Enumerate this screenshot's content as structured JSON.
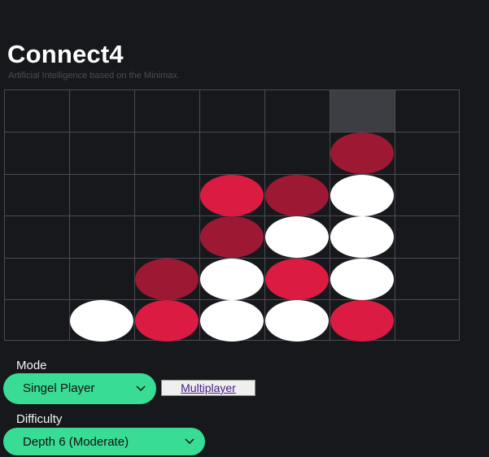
{
  "header": {
    "title": "Connect4",
    "subtitle": "Artificial Intelligence based on the Minimax."
  },
  "board": {
    "columns": 7,
    "rows": 6,
    "hover_column": 5,
    "colors": {
      "white": "#ffffff",
      "red": "#dc1b42",
      "dark": "#9d1933",
      "highlight": "#3c3e43",
      "grid": "#4a4c52"
    },
    "cells": [
      [
        "",
        "",
        "",
        "",
        "",
        "",
        ""
      ],
      [
        "",
        "",
        "",
        "",
        "",
        "dark",
        ""
      ],
      [
        "",
        "",
        "",
        "red",
        "dark",
        "white",
        ""
      ],
      [
        "",
        "",
        "",
        "dark",
        "white",
        "white",
        ""
      ],
      [
        "",
        "",
        "dark",
        "white",
        "red",
        "white",
        ""
      ],
      [
        "",
        "white",
        "red",
        "white",
        "white",
        "red",
        ""
      ]
    ]
  },
  "mode": {
    "label": "Mode",
    "selected": "Singel Player",
    "alternate": "Multiplayer"
  },
  "difficulty": {
    "label": "Difficulty",
    "selected": "Depth 6 (Moderate)"
  },
  "theme": {
    "background": "#17181c",
    "accent": "#39dc95"
  },
  "icons": {
    "dropdown": "chevron-down-icon"
  }
}
